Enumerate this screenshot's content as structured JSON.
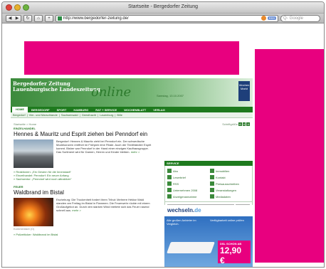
{
  "browser": {
    "title": "Startseite - Bergedorfer Zeitung",
    "url": "http://www.bergedorfer-zeitung.de/",
    "rss_label": "RSS",
    "search_placeholder": "Google"
  },
  "site": {
    "logo_line1": "Bergedorfer Zeitung",
    "logo_line2": "Lauenburgische Landeszeitung",
    "online_label": "online",
    "date": "Samstag, 13.10.2007",
    "badge": "Wochen Markt",
    "nav": [
      "HOME",
      "BERGEDORF",
      "SPORT",
      "HAMBURG",
      "RAT + SERVICE",
      "WOCHENBLATT",
      "VERLAG"
    ],
    "subnav": [
      "Bergedorf",
      "Vier- und Marschlande",
      "Sachsenwald",
      "Geesthacht",
      "Lauenburg",
      "Bille"
    ],
    "breadcrumb": "Startseite > Home",
    "fontsize_label": "Schriftgröße",
    "fontsize_buttons": [
      "A",
      "A",
      "A"
    ]
  },
  "articles": [
    {
      "kicker": "EINZELHANDEL",
      "headline": "Hennes & Mauritz und Esprit ziehen bei Penndorf ein",
      "teaser": "Bergedorf: Hennes & Mauritz zieht bei Penndorf ein. Der schwedische Modekonzern eröffnet im Frühjahr eine Filiale. Auch der Textilhändler Esprit kommt. Bisher war Penndorf in der Hand einer einzigen Kaufhausgruppe. Das Sortiment wird für Damen, Herren und Kinder bleiben.",
      "more": "mehr >",
      "links": [
        "» Reaktionen: „Ein Gewinn für die Innenstadt“",
        "» Einzelhandel: Penndorf: Ein neuer Anfang",
        "» Sachsentor: „Penndorf wird noch attraktiver“"
      ]
    },
    {
      "kicker": "FEUER",
      "headline": "Waldbrand im Bistal",
      "teaser": "Escheburg: Die Trockenheit fordert ihren Tribut: Mehrere Hektar Wald standen am Freitag im Bistal in Flammen. Die Feuerwehr rückte mit einem Großaufgebot an. Durch den starken Wind breitete sich das Feuer rasend schnell aus.",
      "more": "mehr >",
      "comments": "Kommentare (0)",
      "links": [
        "» Polizeiticker: Waldbrand im Bistal"
      ]
    }
  ],
  "services": {
    "header": "SERVICE",
    "items": [
      "Abo",
      "Immobilien",
      "Leserbrief",
      "Kontakt",
      "RSS",
      "Preisausschreiben",
      "Unternehmen 2008",
      "Veranstaltungen",
      "Anzeigenannahme",
      "Mediadaten"
    ],
    "search_button": "Suchen"
  },
  "ad": {
    "brand_main": "wechseln.",
    "brand_suffix": "de",
    "bullet1": "Alle großen Anbieter im Vergleich.",
    "bullet2": "Verfügbarkeit online prüfen",
    "dsl_label": "DSL SCHON AB",
    "price": "12,90 €"
  },
  "colors": {
    "ad_pink": "#e8007f",
    "site_green": "#1e7a1e"
  }
}
